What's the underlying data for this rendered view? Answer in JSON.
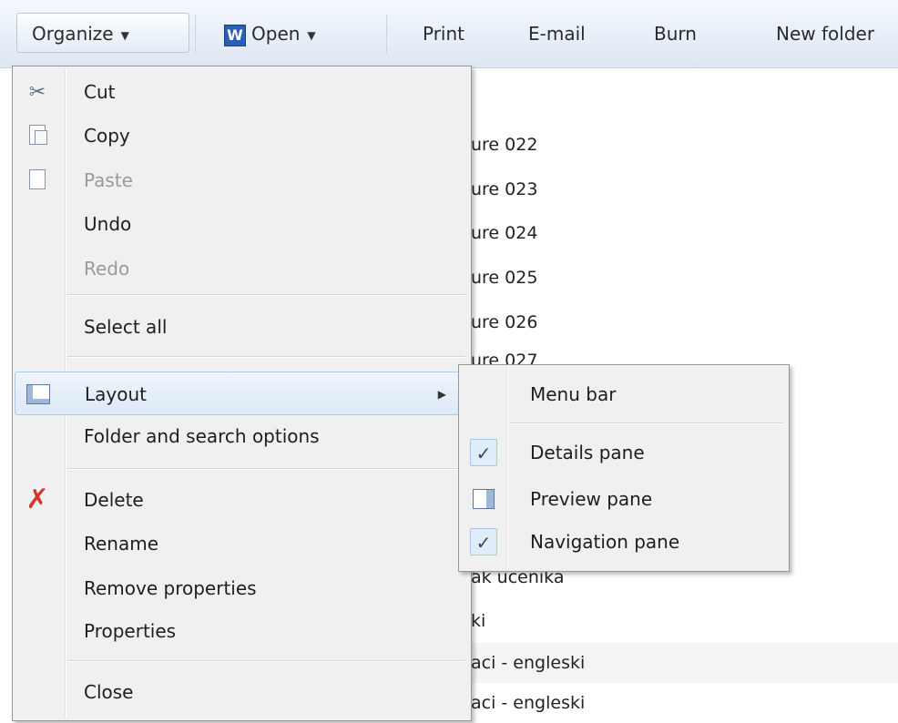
{
  "toolbar": {
    "organize_label": "Organize",
    "open_label": "Open",
    "print_label": "Print",
    "email_label": "E-mail",
    "burn_label": "Burn",
    "new_folder_label": "New folder",
    "word_icon_letter": "W"
  },
  "files": [
    "ure 022",
    "ure 023",
    "ure 024",
    "ure 025",
    "ure 026",
    "ure 027",
    "ak ucenika",
    "ki",
    "aci - engleski",
    "aci - engleski"
  ],
  "organize_menu": {
    "cut": "Cut",
    "copy": "Copy",
    "paste": "Paste",
    "undo": "Undo",
    "redo": "Redo",
    "select_all": "Select all",
    "layout": "Layout",
    "folder_options": "Folder and search options",
    "delete": "Delete",
    "rename": "Rename",
    "remove_properties": "Remove properties",
    "properties": "Properties",
    "close": "Close"
  },
  "layout_submenu": {
    "menu_bar": "Menu bar",
    "details_pane": "Details pane",
    "details_pane_checked": true,
    "preview_pane": "Preview pane",
    "navigation_pane": "Navigation pane",
    "navigation_pane_checked": true
  },
  "icons": {
    "cut": "scissors-icon",
    "copy": "copy-icon",
    "paste": "paste-icon",
    "layout": "layout-icon",
    "delete": "delete-x-icon",
    "preview": "preview-pane-icon",
    "check": "checkmark-icon"
  },
  "colors": {
    "menu_background": "#f0f0f0",
    "highlight_border": "#aecaf0",
    "disabled_text": "#9a9a9a",
    "delete_icon": "#d3372c",
    "toolbar_gradient_top": "#f6f9fd",
    "toolbar_gradient_bottom": "#dde7f2"
  }
}
